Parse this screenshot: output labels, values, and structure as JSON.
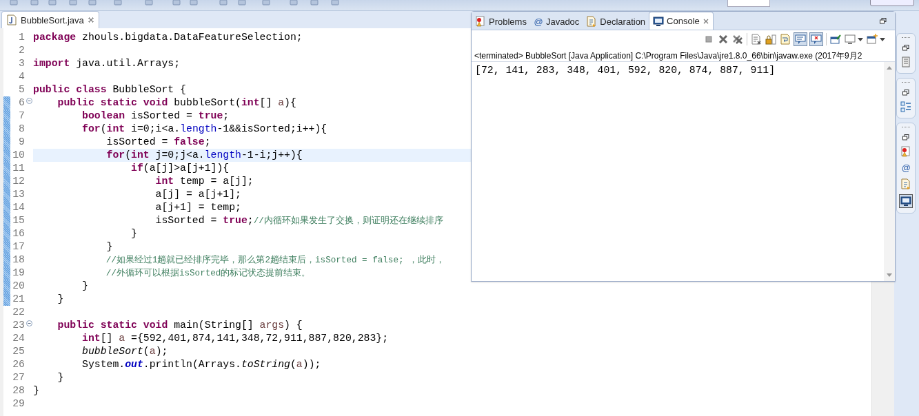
{
  "editor": {
    "tab": {
      "title": "BubbleSort.java",
      "selected": true
    },
    "lines": [
      {
        "number": "1",
        "changed": false,
        "current": false,
        "fold": false,
        "tokens": [
          {
            "kind": "kw",
            "text": "package"
          },
          {
            "kind": "plain",
            "text": " zhouls.bigdata.DataFeatureSelection;"
          }
        ]
      },
      {
        "number": "2",
        "changed": false,
        "current": false,
        "fold": false
      },
      {
        "number": "3",
        "changed": false,
        "current": false,
        "fold": false,
        "tokens": [
          {
            "kind": "kw",
            "text": "import"
          },
          {
            "kind": "plain",
            "text": " java.util.Arrays;"
          }
        ]
      },
      {
        "number": "4",
        "changed": false,
        "current": false,
        "fold": false
      },
      {
        "number": "5",
        "changed": false,
        "current": false,
        "fold": false,
        "tokens": [
          {
            "kind": "kw",
            "text": "public class"
          },
          {
            "kind": "plain",
            "text": " BubbleSort {"
          }
        ]
      },
      {
        "number": "6",
        "changed": true,
        "current": false,
        "fold": true,
        "tokens": [
          {
            "kind": "kw",
            "text": "    public static void"
          },
          {
            "kind": "plain",
            "text": " bubbleSort("
          },
          {
            "kind": "kw",
            "text": "int"
          },
          {
            "kind": "plain",
            "text": "[] "
          },
          {
            "kind": "local",
            "text": "a"
          },
          {
            "kind": "plain",
            "text": "){"
          }
        ]
      },
      {
        "number": "7",
        "changed": true,
        "current": false,
        "fold": false,
        "tokens": [
          {
            "kind": "kw",
            "text": "        boolean"
          },
          {
            "kind": "plain",
            "text": " isSorted = "
          },
          {
            "kind": "kw",
            "text": "true"
          },
          {
            "kind": "plain",
            "text": ";"
          }
        ]
      },
      {
        "number": "8",
        "changed": true,
        "current": false,
        "fold": false,
        "tokens": [
          {
            "kind": "kw",
            "text": "        for"
          },
          {
            "kind": "plain",
            "text": "("
          },
          {
            "kind": "kw",
            "text": "int"
          },
          {
            "kind": "plain",
            "text": " i=0;i<a."
          },
          {
            "kind": "field",
            "text": "length"
          },
          {
            "kind": "plain",
            "text": "-1&&isSorted;i++){"
          }
        ]
      },
      {
        "number": "9",
        "changed": true,
        "current": false,
        "fold": false,
        "tokens": [
          {
            "kind": "plain",
            "text": "            isSorted = "
          },
          {
            "kind": "kw",
            "text": "false"
          },
          {
            "kind": "plain",
            "text": ";"
          }
        ]
      },
      {
        "number": "10",
        "changed": true,
        "current": true,
        "fold": false,
        "tokens": [
          {
            "kind": "kw",
            "text": "            for"
          },
          {
            "kind": "plain",
            "text": "("
          },
          {
            "kind": "kw",
            "text": "int"
          },
          {
            "kind": "plain",
            "text": " j=0;j<a."
          },
          {
            "kind": "field",
            "text": "length"
          },
          {
            "kind": "plain",
            "text": "-1-i;j++){"
          }
        ]
      },
      {
        "number": "11",
        "changed": true,
        "current": false,
        "fold": false,
        "tokens": [
          {
            "kind": "kw",
            "text": "                if"
          },
          {
            "kind": "plain",
            "text": "(a[j]>a[j+1]){"
          }
        ]
      },
      {
        "number": "12",
        "changed": true,
        "current": false,
        "fold": false,
        "tokens": [
          {
            "kind": "kw",
            "text": "                    int"
          },
          {
            "kind": "plain",
            "text": " temp = a[j];"
          }
        ]
      },
      {
        "number": "13",
        "changed": true,
        "current": false,
        "fold": false,
        "tokens": [
          {
            "kind": "plain",
            "text": "                    a[j] = a[j+1];"
          }
        ]
      },
      {
        "number": "14",
        "changed": true,
        "current": false,
        "fold": false,
        "tokens": [
          {
            "kind": "plain",
            "text": "                    a[j+1] = temp;"
          }
        ]
      },
      {
        "number": "15",
        "changed": true,
        "current": false,
        "fold": false,
        "tokens": [
          {
            "kind": "plain",
            "text": "                    isSorted = "
          },
          {
            "kind": "kw",
            "text": "true"
          },
          {
            "kind": "plain",
            "text": ";"
          },
          {
            "kind": "comment",
            "text": "//内循环如果发生了交换，则证明还在继续排序"
          }
        ]
      },
      {
        "number": "16",
        "changed": true,
        "current": false,
        "fold": false,
        "tokens": [
          {
            "kind": "plain",
            "text": "                }"
          }
        ]
      },
      {
        "number": "17",
        "changed": true,
        "current": false,
        "fold": false,
        "tokens": [
          {
            "kind": "plain",
            "text": "            }"
          }
        ]
      },
      {
        "number": "18",
        "changed": true,
        "current": false,
        "fold": false,
        "tokens": [
          {
            "kind": "comment",
            "text": "              //如果经过1趟就已经排序完毕，那么第2趟结束后，isSorted = false; ，此时，"
          }
        ]
      },
      {
        "number": "19",
        "changed": true,
        "current": false,
        "fold": false,
        "tokens": [
          {
            "kind": "comment",
            "text": "              //外循环可以根据isSorted的标记状态提前结束。"
          }
        ]
      },
      {
        "number": "20",
        "changed": true,
        "current": false,
        "fold": false,
        "tokens": [
          {
            "kind": "plain",
            "text": "        }"
          }
        ]
      },
      {
        "number": "21",
        "changed": true,
        "current": false,
        "fold": false,
        "tokens": [
          {
            "kind": "plain",
            "text": "    }"
          }
        ]
      },
      {
        "number": "22",
        "changed": false,
        "current": false,
        "fold": false
      },
      {
        "number": "23",
        "changed": false,
        "current": false,
        "fold": true,
        "tokens": [
          {
            "kind": "kw",
            "text": "    public static void"
          },
          {
            "kind": "plain",
            "text": " main(String[] "
          },
          {
            "kind": "local",
            "text": "args"
          },
          {
            "kind": "plain",
            "text": ") {"
          }
        ]
      },
      {
        "number": "24",
        "changed": false,
        "current": false,
        "fold": false,
        "tokens": [
          {
            "kind": "kw",
            "text": "        int"
          },
          {
            "kind": "plain",
            "text": "[] "
          },
          {
            "kind": "local",
            "text": "a"
          },
          {
            "kind": "plain",
            "text": " ={592,401,874,141,348,72,911,887,820,283};"
          }
        ]
      },
      {
        "number": "25",
        "changed": false,
        "current": false,
        "fold": false,
        "tokens": [
          {
            "kind": "italic",
            "text": "        bubbleSort"
          },
          {
            "kind": "plain",
            "text": "("
          },
          {
            "kind": "local",
            "text": "a"
          },
          {
            "kind": "plain",
            "text": ");"
          }
        ]
      },
      {
        "number": "26",
        "changed": false,
        "current": false,
        "fold": false,
        "tokens": [
          {
            "kind": "plain",
            "text": "        System."
          },
          {
            "kind": "static",
            "text": "out"
          },
          {
            "kind": "plain",
            "text": ".println(Arrays."
          },
          {
            "kind": "italic",
            "text": "toString"
          },
          {
            "kind": "plain",
            "text": "("
          },
          {
            "kind": "local",
            "text": "a"
          },
          {
            "kind": "plain",
            "text": "));"
          }
        ]
      },
      {
        "number": "27",
        "changed": false,
        "current": false,
        "fold": false,
        "tokens": [
          {
            "kind": "plain",
            "text": "    }"
          }
        ]
      },
      {
        "number": "28",
        "changed": false,
        "current": false,
        "fold": false,
        "tokens": [
          {
            "kind": "plain",
            "text": "}"
          }
        ]
      },
      {
        "number": "29",
        "changed": false,
        "current": false,
        "fold": false
      }
    ]
  },
  "console": {
    "tabs": [
      {
        "kind": "problems",
        "label": "Problems",
        "selected": false
      },
      {
        "kind": "javadoc",
        "glyph": "@",
        "label": "Javadoc",
        "selected": false
      },
      {
        "kind": "declaration",
        "label": "Declaration",
        "selected": false
      },
      {
        "kind": "console",
        "label": "Console",
        "selected": true
      }
    ],
    "status": "<terminated> BubbleSort [Java Application] C:\\Program Files\\Java\\jre1.8.0_66\\bin\\javaw.exe (2017年9月2",
    "output": "[72, 141, 283, 348, 401, 592, 820, 874, 887, 911]"
  },
  "trim": {
    "glyph": "@"
  }
}
